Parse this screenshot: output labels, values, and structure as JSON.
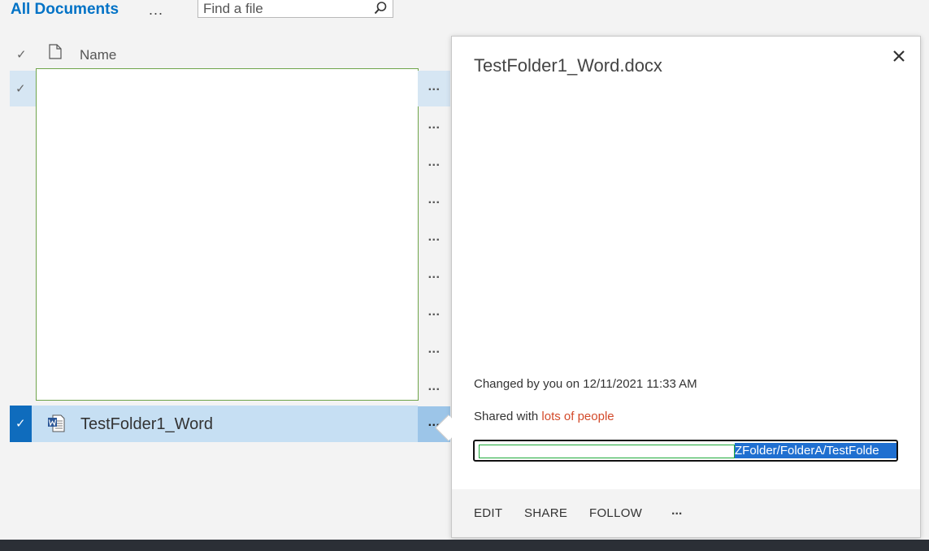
{
  "header": {
    "view_title": "All Documents",
    "view_more": "...",
    "search": {
      "placeholder": "Find a file",
      "value": ""
    }
  },
  "columns": {
    "check": "✓",
    "name": "Name"
  },
  "rows": [
    {
      "check": "✓",
      "more": "..."
    },
    {
      "more": "..."
    },
    {
      "more": "..."
    },
    {
      "more": "..."
    },
    {
      "more": "..."
    },
    {
      "more": "..."
    },
    {
      "more": "..."
    },
    {
      "more": "..."
    },
    {
      "more": "..."
    }
  ],
  "selected_row": {
    "check": "✓",
    "name": "TestFolder1_Word",
    "more": "...",
    "icon": "word-file-icon"
  },
  "callout": {
    "title": "TestFolder1_Word.docx",
    "changed_by": "Changed by you on 12/11/2021 11:33 AM",
    "shared_prefix": "Shared with ",
    "shared_link": "lots of people",
    "url_visible": "ZFolder/FolderA/TestFolde",
    "actions": {
      "edit": "EDIT",
      "share": "SHARE",
      "follow": "FOLLOW",
      "more": "..."
    }
  },
  "colors": {
    "accent": "#0072c6",
    "selected_row": "#c6dff3",
    "check_box": "#0f6cbd",
    "link": "#d34a2a",
    "selection_highlight": "#1f6fd0"
  }
}
